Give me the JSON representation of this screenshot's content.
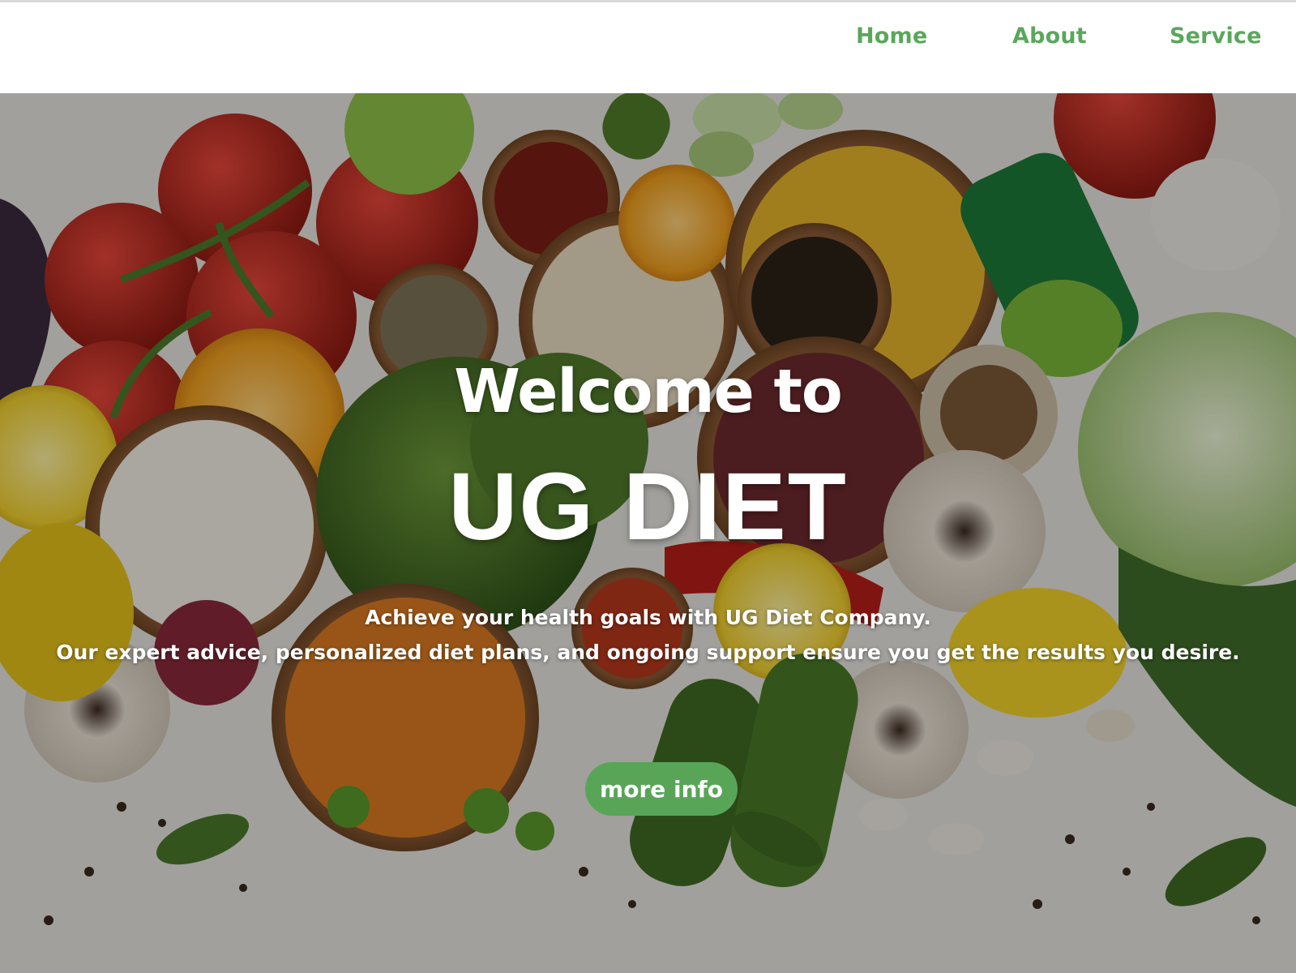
{
  "nav": {
    "items": [
      {
        "label": "Home"
      },
      {
        "label": "About"
      },
      {
        "label": "Service"
      }
    ]
  },
  "hero": {
    "welcome": "Welcome to",
    "brand": "UG DIET",
    "line1": "Achieve your health goals with UG Diet Company.",
    "line2": "Our expert advice, personalized diet plans, and ongoing support ensure you get the results you desire.",
    "button_label": "more info"
  },
  "colors": {
    "accent": "#5aa75c",
    "button": "#58a558",
    "hero_text": "#ffffff"
  }
}
